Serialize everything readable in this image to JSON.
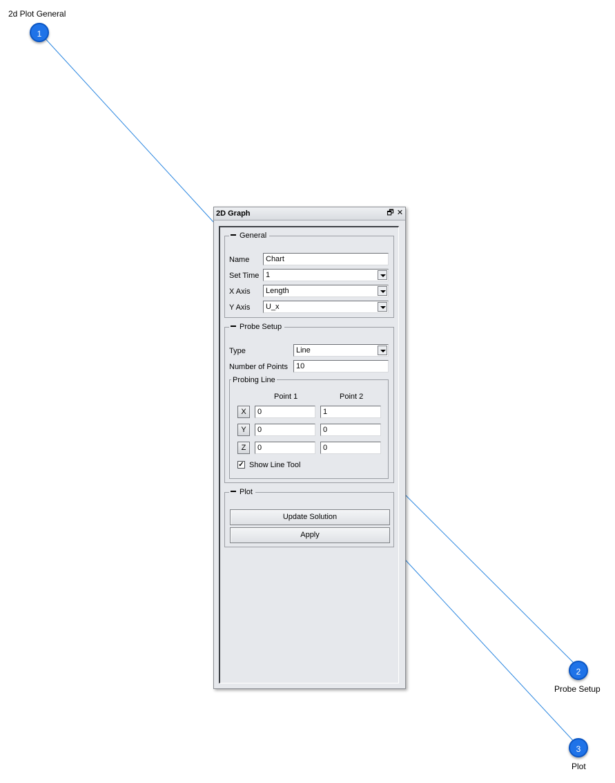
{
  "callouts": [
    {
      "number": "1",
      "label": "2d Plot General"
    },
    {
      "number": "2",
      "label": "Probe Setup"
    },
    {
      "number": "3",
      "label": "Plot"
    }
  ],
  "panel": {
    "title": "2D Graph",
    "restore_icon": "restore-window-icon",
    "close_icon": "close-icon",
    "restore_glyph": "🗗",
    "close_glyph": "✕"
  },
  "general": {
    "heading": "General",
    "name_label": "Name",
    "name_value": "Chart",
    "set_time_label": "Set Time",
    "set_time_value": "1",
    "x_axis_label": "X Axis",
    "x_axis_value": "Length",
    "y_axis_label": "Y Axis",
    "y_axis_value": "U_x"
  },
  "probe_setup": {
    "heading": "Probe Setup",
    "type_label": "Type",
    "type_value": "Line",
    "num_points_label": "Number of Points",
    "num_points_value": "10",
    "probing_line": {
      "heading": "Probing Line",
      "col1": "Point 1",
      "col2": "Point 2",
      "rows": [
        {
          "axis": "X",
          "p1": "0",
          "p2": "1"
        },
        {
          "axis": "Y",
          "p1": "0",
          "p2": "0"
        },
        {
          "axis": "Z",
          "p1": "0",
          "p2": "0"
        }
      ],
      "show_line_tool_label": "Show Line Tool",
      "show_line_tool_checked": true,
      "check_glyph": "✓"
    }
  },
  "plot": {
    "heading": "Plot",
    "update_button": "Update Solution",
    "apply_button": "Apply"
  },
  "colors": {
    "badge": "#1f73e8",
    "callout_line": "#2a86e0",
    "panel_bg": "#e6e8ec"
  }
}
